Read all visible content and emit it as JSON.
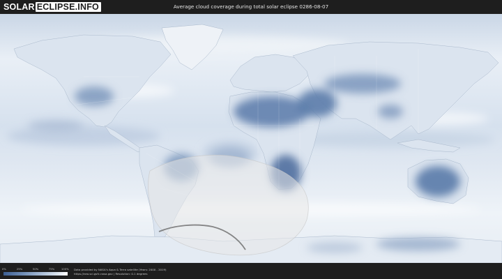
{
  "brand": {
    "part1": "SOLAR",
    "part2": "ECLIPSE.INFO"
  },
  "title": "Average cloud coverage during total solar eclipse 0286-08-07",
  "legend": {
    "ticks": [
      "0%",
      "25%",
      "50%",
      "75%",
      "100%"
    ],
    "colors": {
      "clear": "#3d5f93",
      "overcast": "#ffffff"
    }
  },
  "credits": {
    "line1": "Data provided by NASA's Aqua & Terra satellite (Years: 2000 - 2019)",
    "line2": "https://neo.sci.gsfc.nasa.gov | Resolution: 0.1 degrees"
  },
  "map": {
    "ocean_color": "#dfe8f2",
    "land_clear_color": "#6b89b3",
    "eclipse_shadow_color": "#e8e8e8",
    "totality_path_color": "#6a6a6a"
  }
}
